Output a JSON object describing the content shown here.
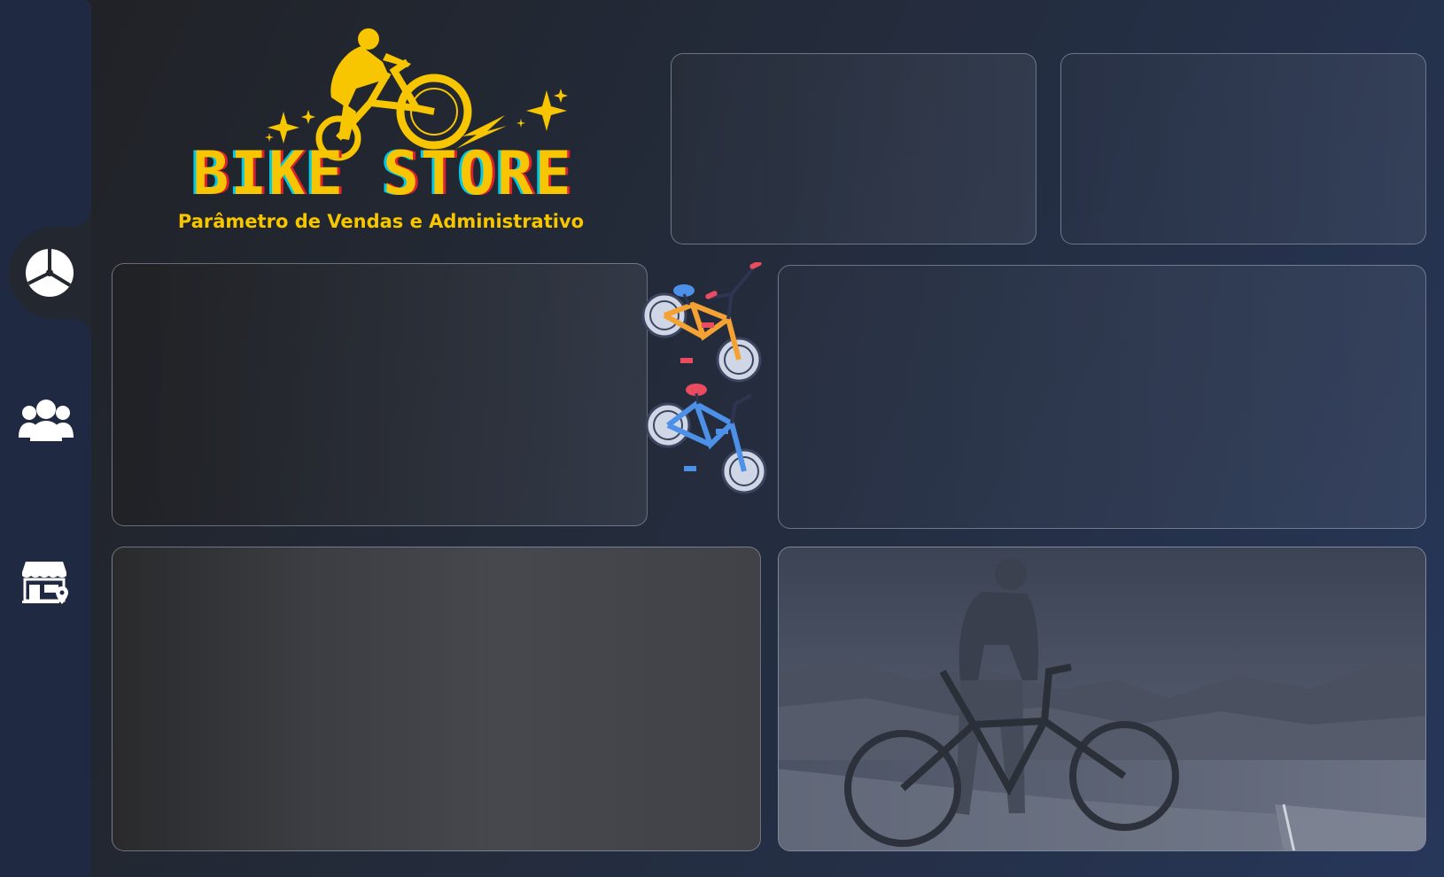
{
  "brand": {
    "title": "BIKE STORE",
    "subtitle": "Parâmetro de Vendas e Administrativo",
    "color": "#f7c600"
  },
  "sidebar": {
    "items": [
      {
        "icon": "pie-chart-icon",
        "active": true
      },
      {
        "icon": "users-icon",
        "active": false
      },
      {
        "icon": "store-location-icon",
        "active": false
      }
    ],
    "background": "#1f2a42"
  },
  "cards": [
    {
      "name": "kpi-card-1"
    },
    {
      "name": "kpi-card-2"
    },
    {
      "name": "chart-card-left"
    },
    {
      "name": "chart-card-right"
    },
    {
      "name": "chart-card-bottom"
    },
    {
      "name": "photo-card-cyclist"
    }
  ],
  "decor": {
    "bikes_illustration": "bikes-illustration",
    "photo": "cyclist-photo"
  }
}
